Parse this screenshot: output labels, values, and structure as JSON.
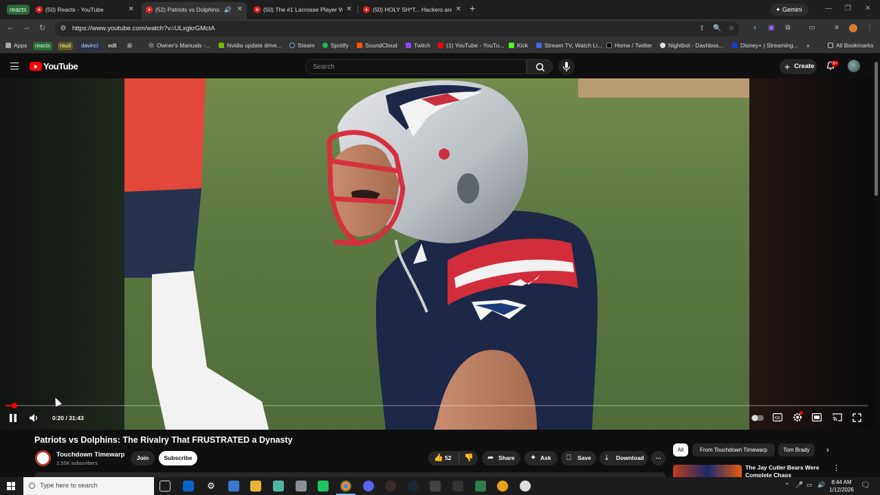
{
  "browser": {
    "tab_group_label": "reacts",
    "tabs": [
      {
        "title": "(50) Reacts - YouTube",
        "active": false
      },
      {
        "title": "(52) Patriots vs Dolphins: Th",
        "active": true
      },
      {
        "title": "(50) The #1 Lacrosse Player Wh",
        "active": false
      },
      {
        "title": "(50) HOLY SH*T... Hackers are u",
        "active": false
      }
    ],
    "new_tab": "+",
    "gemini_label": "Gemini",
    "url": "https://www.youtube.com/watch?v=ULxgkrGMctA",
    "bookmarks": [
      {
        "label": "Apps"
      },
      {
        "label": "reacts",
        "chip": true
      },
      {
        "label": "raud",
        "chip": true
      },
      {
        "label": "davinci",
        "chip": true
      },
      {
        "label": "edit",
        "chip": true
      },
      {
        "label": "Owner's Manuals -..."
      },
      {
        "label": "Nvidia update drive..."
      },
      {
        "label": "Steam"
      },
      {
        "label": "Spotify"
      },
      {
        "label": "SoundCloud"
      },
      {
        "label": "Twitch"
      },
      {
        "label": "(1) YouTube - YouTu..."
      },
      {
        "label": "Kick"
      },
      {
        "label": "Stream TV, Watch Li..."
      },
      {
        "label": "Home / Twitter"
      },
      {
        "label": "Nightbot - Dashboa..."
      },
      {
        "label": "Disney+ | Streaming..."
      }
    ],
    "all_bookmarks": "All Bookmarks",
    "more_bookmarks": "»"
  },
  "youtube": {
    "logo_text": "YouTube",
    "search_placeholder": "Search",
    "create_label": "Create",
    "notification_count": "9+",
    "player": {
      "time_current": "0:20",
      "time_total": "31:43",
      "time_display": "0:20 / 31:43",
      "progress_fraction": 0.0105,
      "state": "playing"
    },
    "video": {
      "title": "Patriots vs Dolphins: The Rivalry That FRUSTRATED a Dynasty",
      "channel": "Touchdown Timewarp",
      "subscribers": "2.55K subscribers",
      "join_label": "Join",
      "subscribe_label": "Subscribe",
      "likes": "52",
      "share_label": "Share",
      "ask_label": "Ask",
      "save_label": "Save",
      "download_label": "Download"
    },
    "chips": [
      "All",
      "From Touchdown Timewarp",
      "Tom Brady"
    ],
    "recommended": [
      {
        "title": "The Jay Cutler Bears Were Complete Chaos"
      }
    ]
  },
  "taskbar": {
    "search_placeholder": "Type here to search",
    "time": "8:44 AM",
    "date": "1/12/2026"
  }
}
